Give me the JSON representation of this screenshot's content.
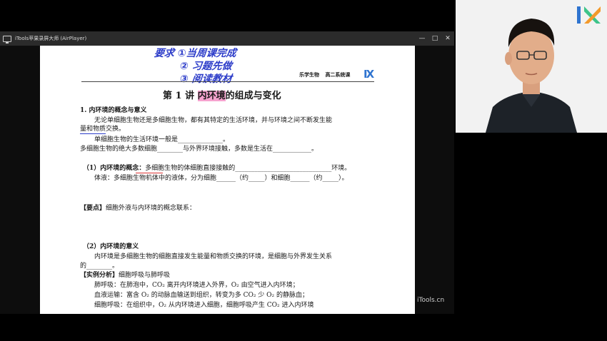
{
  "window": {
    "title": "iTools苹果录屏大师 (AirPlayer)",
    "minimize": "—",
    "maximize": "□",
    "close": "✕"
  },
  "document": {
    "handwriting": {
      "line1": "要求 ①当周课完成",
      "line2": "② 习题先做",
      "line3": "③ 阅读教材"
    },
    "header_subject": "乐学生物",
    "header_course": "高二系统课",
    "logo_text": "IX",
    "lesson_prefix": "第 1 讲",
    "lesson_highlight": "内环境",
    "lesson_suffix": "的组成与变化",
    "section1_title": "1. 内环境的概念与意义",
    "p1": "无论单细胞生物还是多细胞生物，都有其特定的生活环境，并与环境之间不断发生能",
    "p1b": "量和物质交换。",
    "p2": "单细胞生物的生活环境一般是______________。",
    "p3": "多细胞生物的绝大多数细胞________与外界环境接触，多数是生活在____________。",
    "concept_title": "（1）内环境的概念：",
    "concept_text": "多细胞生物的体细胞直接接触的______________________________环境。",
    "body_fluid": "体液：多细胞生物机体中的液体，分为细胞______（约_____）和细胞______（约_____）。",
    "keypoint_label": "【要点】",
    "keypoint_text": "细胞外液与内环境的概念联系：",
    "meaning_title": "（2）内环境的意义",
    "meaning_text": "内环境是多细胞生物的细胞直接发生能量和物质交换的环境，是细胞与外界发生关系",
    "meaning_text2": "的________。",
    "example_label": "【实例分析】",
    "example_text": "细胞呼吸与肺呼吸",
    "lung": "肺呼吸：在肺泡中，CO₂ 离开内环境进入外界，O₂ 由空气进入内环境；",
    "blood": "血液运输：富含 O₂ 的动脉血输送到组织，转变为多 CO₂ 少 O₂ 的静脉血；",
    "cell_resp": "细胞呼吸：在组织中，O₂ 从内环境进入细胞，细胞呼吸产生 CO₂ 进入内环境"
  },
  "watermark": "iTools.cn",
  "colors": {
    "ink": "#2c3cc9",
    "highlight": "#f6a3cf",
    "logo_blue": "#2f74d0",
    "logo_light": "#4ab0e6",
    "cam_logo_green": "#3ec48a",
    "cam_logo_orange": "#f39a2b"
  }
}
